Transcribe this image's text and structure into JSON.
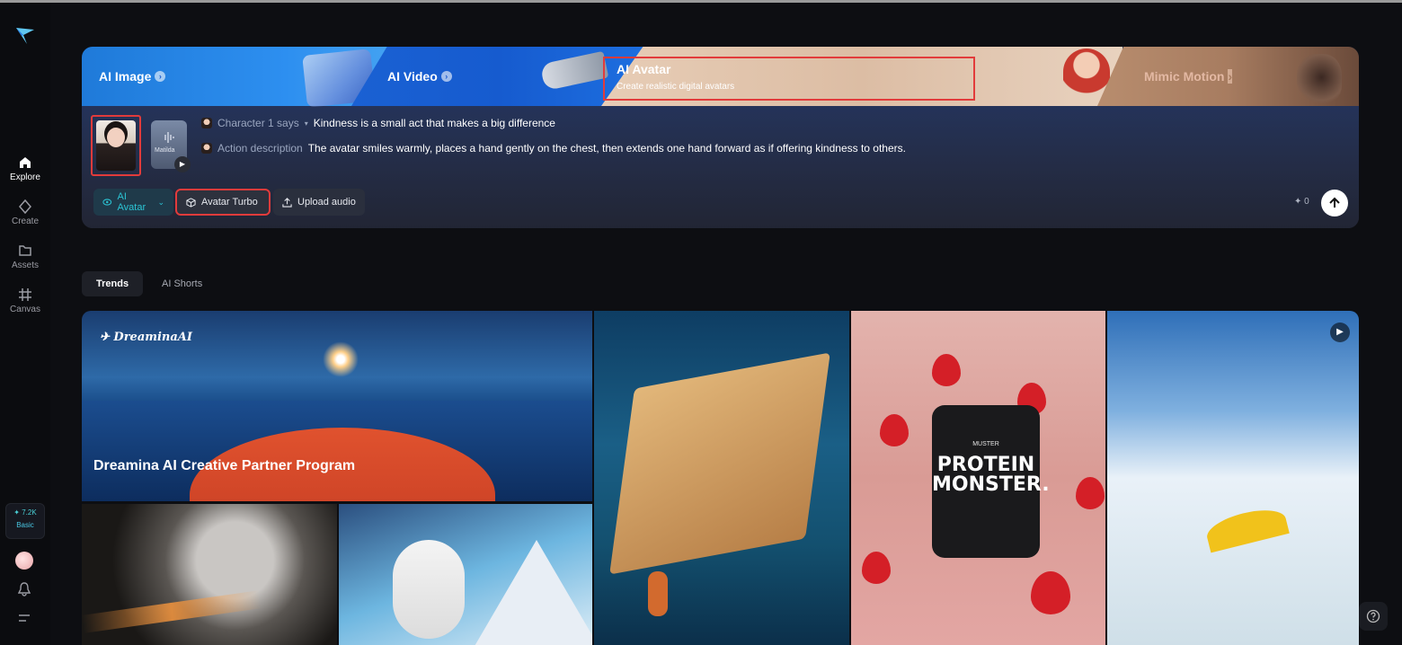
{
  "sidebar": {
    "nav": [
      {
        "label": "Explore",
        "icon": "home-icon"
      },
      {
        "label": "Create",
        "icon": "sparkle-icon"
      },
      {
        "label": "Assets",
        "icon": "folder-icon"
      },
      {
        "label": "Canvas",
        "icon": "canvas-icon"
      }
    ],
    "credits": "7.2K",
    "plan": "Basic"
  },
  "hero": {
    "tabs": [
      {
        "label": "AI Image"
      },
      {
        "label": "AI Video"
      },
      {
        "label": "AI Avatar",
        "subtitle": "Create realistic digital avatars"
      },
      {
        "label": "Mimic Motion"
      }
    ],
    "audio_name": "Matilda",
    "character_label": "Character 1 says",
    "character_text": "Kindness is a small act that makes a big difference",
    "action_label": "Action description",
    "action_text": "The avatar smiles warmly, places a hand gently on the chest, then extends one hand forward as if offering kindness to others.",
    "mode": "AI Avatar",
    "model": "Avatar Turbo",
    "upload": "Upload audio",
    "cost": "0"
  },
  "section_tabs": [
    "Trends",
    "AI Shorts"
  ],
  "gallery": {
    "brand": "DreaminaAI",
    "feature_title": "Dreamina AI Creative Partner Program",
    "product_brand": "MUSTER",
    "product_name": "PROTEIN MONSTER."
  },
  "colors": {
    "accent": "#2bc4d4",
    "highlight": "#e23b3b"
  }
}
